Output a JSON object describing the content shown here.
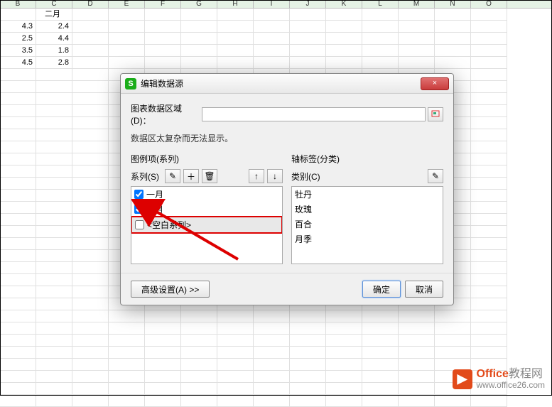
{
  "sheet": {
    "columns": [
      "B",
      "C",
      "D",
      "E",
      "F",
      "G",
      "H",
      "I",
      "J",
      "K",
      "L",
      "M",
      "N",
      "O"
    ],
    "row_header": "二月",
    "data": [
      [
        "4.3",
        "2.4"
      ],
      [
        "2.5",
        "4.4"
      ],
      [
        "3.5",
        "1.8"
      ],
      [
        "4.5",
        "2.8"
      ]
    ]
  },
  "dialog": {
    "title": "编辑数据源",
    "close_icon": "×",
    "range_label": "图表数据区域(D)：",
    "hint": "数据区太复杂而无法显示。",
    "left_panel_title": "图例项(系列)",
    "series_label": "系列(S)",
    "edit_icon": "✎",
    "add_icon": "＋",
    "del_icon": "🗑",
    "up_icon": "↑",
    "down_icon": "↓",
    "series_items": [
      {
        "label": "一月",
        "checked": true
      },
      {
        "label": "二月",
        "checked": true
      },
      {
        "label": "<空白系列>",
        "checked": false,
        "highlight": true
      }
    ],
    "right_panel_title": "轴标签(分类)",
    "category_label": "类别(C)",
    "categories": [
      "牡丹",
      "玫瑰",
      "百合",
      "月季"
    ],
    "advanced": "高级设置(A) >>",
    "ok": "确定",
    "cancel": "取消"
  },
  "watermark": {
    "brand_colored": "Office",
    "brand_rest": "教程网",
    "url": "www.office26.com"
  }
}
